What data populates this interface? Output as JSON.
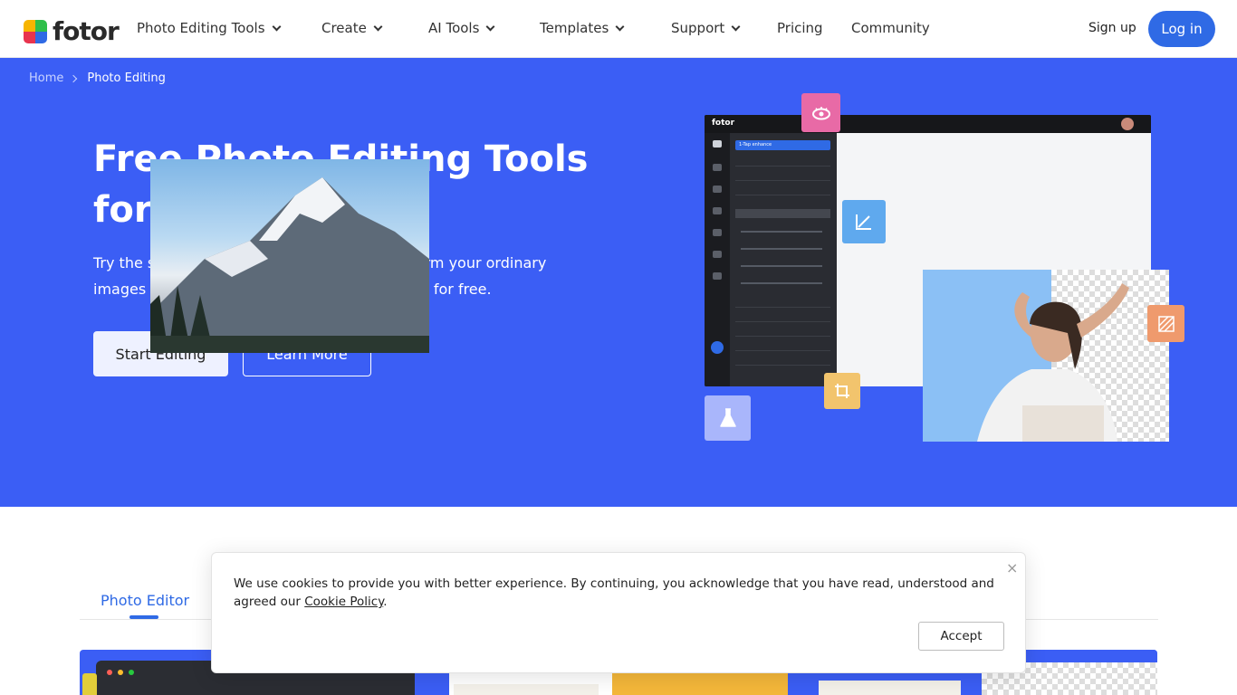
{
  "header": {
    "logo_text": "fotor",
    "nav": [
      {
        "label": "Photo Editing Tools",
        "dropdown": true
      },
      {
        "label": "Create",
        "dropdown": true
      },
      {
        "label": "AI Tools",
        "dropdown": true
      },
      {
        "label": "Templates",
        "dropdown": true
      },
      {
        "label": "Support",
        "dropdown": true
      },
      {
        "label": "Pricing",
        "dropdown": false
      },
      {
        "label": "Community",
        "dropdown": false
      }
    ],
    "signup_label": "Sign up",
    "login_label": "Log in"
  },
  "breadcrumb": {
    "home": "Home",
    "current": "Photo Editing"
  },
  "hero": {
    "title": "Free Photo Editing Tools for Everyone",
    "subtitle": "Try the simplest photo editing tools to transform your ordinary images into incredible things in a few seconds for free.",
    "start_label": "Start Editing",
    "learn_label": "Learn More",
    "mock_logo": "fotor",
    "mock_enhance": "1-Tap enhance"
  },
  "tabs": {
    "active": "Photo Editor"
  },
  "cookie": {
    "text": "We use cookies to provide you with better experience. By continuing, you acknowledge that you have read, understood and agreed our ",
    "link": "Cookie Policy",
    "end": ".",
    "accept_label": "Accept",
    "close": "×"
  },
  "colors": {
    "brand_blue": "#3b5ef5",
    "button_blue": "#2f6ae5"
  },
  "icons": {
    "float_eye": "eye-icon",
    "float_straighten": "straighten-icon",
    "float_crop": "crop-icon",
    "float_flask": "flask-icon",
    "float_pattern": "pattern-icon"
  }
}
